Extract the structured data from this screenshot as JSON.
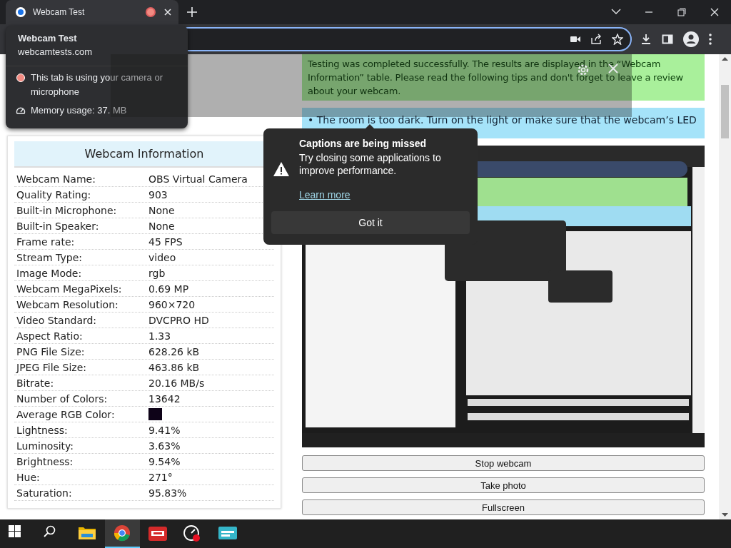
{
  "browser": {
    "tabs": [
      {
        "title": "Webcam Test",
        "selected": true,
        "recording": true
      }
    ]
  },
  "hover_card": {
    "title": "Webcam Test",
    "url": "webcamtests.com",
    "notice": "This tab is using your camera or microphone",
    "memory": "Memory usage: 37. MB"
  },
  "page": {
    "success_message": "Testing was completed successfully. The results are displayed in the “Webcam Information” table. Please read the following tips and don't forget to leave a review about your webcam.",
    "tips": [
      "• The room is too dark. Turn on the light or make sure that the webcam’s LED"
    ],
    "info": {
      "heading": "Webcam Information",
      "rows": [
        {
          "label": "Webcam Name:",
          "value": "OBS Virtual Camera",
          "kind": "text"
        },
        {
          "label": "Quality Rating:",
          "value": "903",
          "kind": "text"
        },
        {
          "label": "Built-in Microphone:",
          "value": "None",
          "kind": "text"
        },
        {
          "label": "Built-in Speaker:",
          "value": "None",
          "kind": "text"
        },
        {
          "label": "Frame rate:",
          "value": "45 FPS",
          "kind": "text"
        },
        {
          "label": "Stream Type:",
          "value": "video",
          "kind": "text"
        },
        {
          "label": "Image Mode:",
          "value": "rgb",
          "kind": "text"
        },
        {
          "label": "Webcam MegaPixels:",
          "value": "0.69 MP",
          "kind": "text"
        },
        {
          "label": "Webcam Resolution:",
          "value": "960×720",
          "kind": "text"
        },
        {
          "label": "Video Standard:",
          "value": "DVCPRO HD",
          "kind": "text"
        },
        {
          "label": "Aspect Ratio:",
          "value": "1.33",
          "kind": "text"
        },
        {
          "label": "PNG File Size:",
          "value": "628.26 kB",
          "kind": "text"
        },
        {
          "label": "JPEG File Size:",
          "value": "463.86 kB",
          "kind": "text"
        },
        {
          "label": "Bitrate:",
          "value": "20.16 MB/s",
          "kind": "text"
        },
        {
          "label": "Number of Colors:",
          "value": "13642",
          "kind": "text"
        },
        {
          "label": "Average RGB Color:",
          "color": "#0e0318",
          "kind": "swatch"
        },
        {
          "label": "Lightness:",
          "value": "9.41%",
          "kind": "text"
        },
        {
          "label": "Luminosity:",
          "value": "3.63%",
          "kind": "text"
        },
        {
          "label": "Brightness:",
          "value": "9.54%",
          "kind": "text"
        },
        {
          "label": "Hue:",
          "value": "271°",
          "kind": "text"
        },
        {
          "label": "Saturation:",
          "value": "95.83%",
          "kind": "text"
        }
      ]
    },
    "buttons": [
      "Stop webcam",
      "Take photo",
      "Fullscreen"
    ]
  },
  "popup": {
    "title": "Captions are being missed",
    "body": "Try closing some applications to improve performance.",
    "link": "Learn more",
    "button": "Got it"
  },
  "taskbar": {
    "apps": [
      {
        "kind": "start",
        "selected": false
      },
      {
        "kind": "search",
        "selected": false
      },
      {
        "kind": "folder",
        "selected": false
      },
      {
        "kind": "browser",
        "selected": true
      },
      {
        "kind": "red-app",
        "selected": false
      },
      {
        "kind": "gauge-app",
        "selected": false
      },
      {
        "kind": "teal-app",
        "selected": false
      }
    ]
  }
}
